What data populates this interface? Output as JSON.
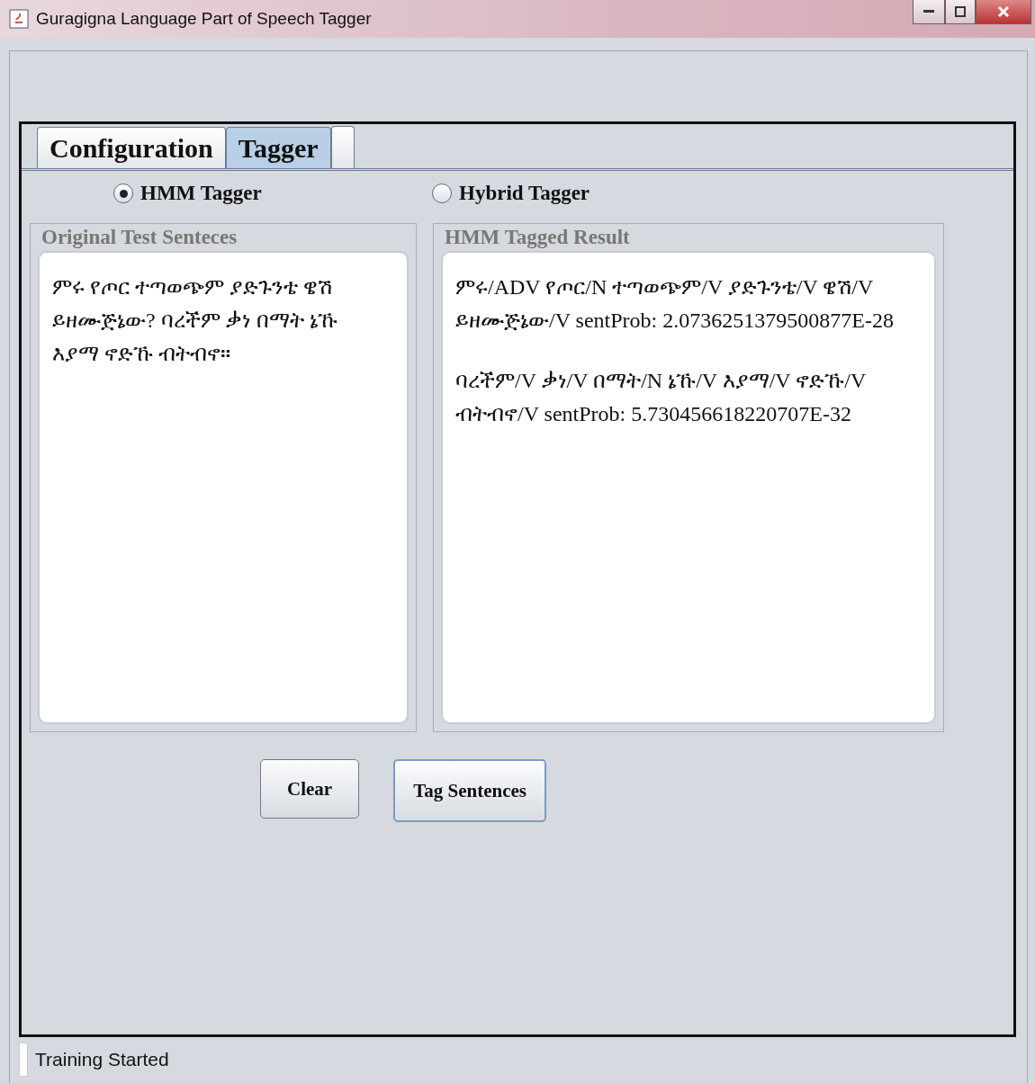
{
  "window": {
    "title": "Guragigna Language Part of Speech Tagger"
  },
  "tabs": [
    {
      "label": "Configuration",
      "selected": false
    },
    {
      "label": "Tagger",
      "selected": true
    }
  ],
  "taggers": [
    {
      "label": "HMM Tagger",
      "selected": true
    },
    {
      "label": "Hybrid Tagger",
      "selected": false
    }
  ],
  "panels": [
    {
      "title": "Original Test Senteces",
      "paragraphs": [
        "ምሩ የጦር ተጣወጭም ያድጉንቴ ዌሽ ይዘሙጅኔው? ባረችም ቃነ በማት ኔኹ እያማ ኖድኹ ብትብኖ።"
      ]
    },
    {
      "title": "HMM Tagged Result",
      "paragraphs": [
        "ምሩ/ADV የጦር/N ተጣወጭም/V ያድጉንቴ/V ዌሽ/V ይዘሙጅኔው/V sentProb: 2.0736251379500877E-28",
        "ባረችም/V ቃነ/V በማት/N ኔኹ/V እያማ/V ኖድኹ/V ብትብኖ/V sentProb: 5.730456618220707E-32"
      ]
    }
  ],
  "buttons": [
    {
      "label": "Clear",
      "focused": false
    },
    {
      "label": "Tag Sentences",
      "focused": true
    }
  ],
  "status_bar": "Training Started"
}
